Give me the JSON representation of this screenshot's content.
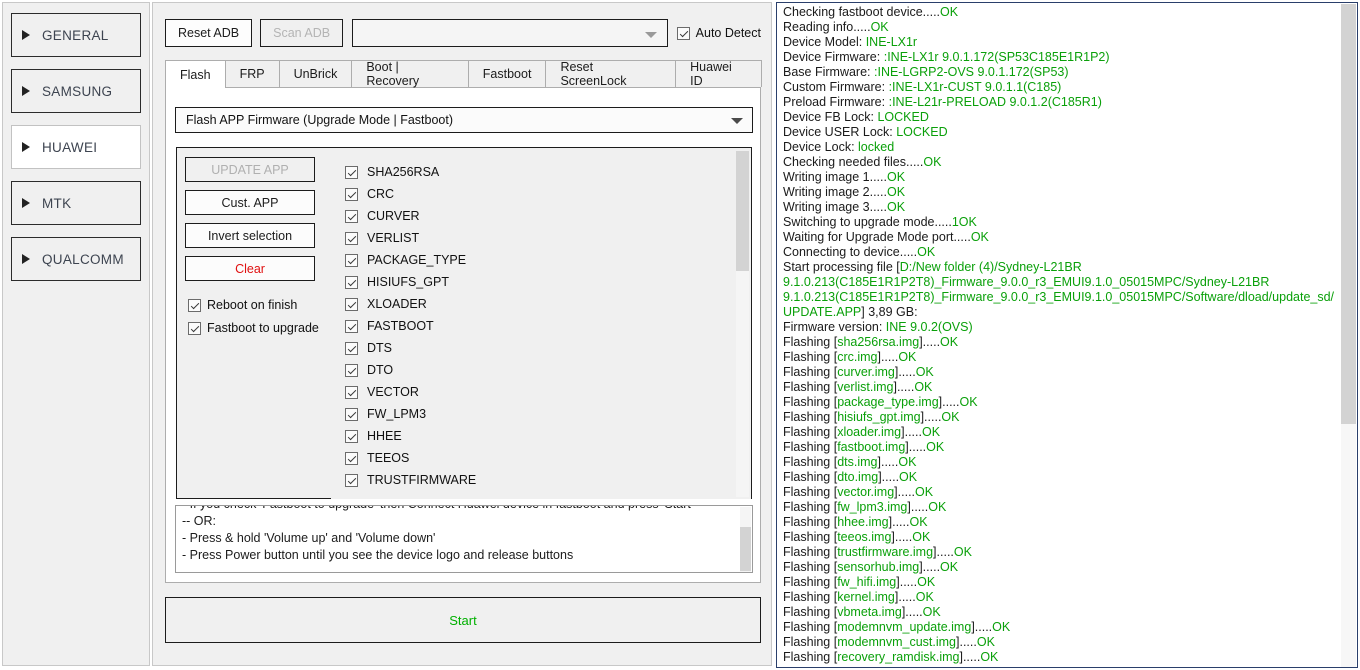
{
  "sidebar": {
    "items": [
      {
        "label": "GENERAL",
        "active": false
      },
      {
        "label": "SAMSUNG",
        "active": false
      },
      {
        "label": "HUAWEI",
        "active": true
      },
      {
        "label": "MTK",
        "active": false
      },
      {
        "label": "QUALCOMM",
        "active": false
      }
    ]
  },
  "toolbar": {
    "reset_adb": "Reset ADB",
    "scan_adb": "Scan ADB",
    "device_combo_value": "",
    "auto_detect_label": "Auto Detect",
    "auto_detect_checked": true
  },
  "tabs": [
    {
      "label": "Flash",
      "active": true
    },
    {
      "label": "FRP",
      "active": false
    },
    {
      "label": "UnBrick",
      "active": false
    },
    {
      "label": "Boot | Recovery",
      "active": false
    },
    {
      "label": "Fastboot",
      "active": false
    },
    {
      "label": "Reset ScreenLock",
      "active": false
    },
    {
      "label": "Huawei ID",
      "active": false
    }
  ],
  "flash": {
    "mode_value": "Flash APP Firmware (Upgrade Mode | Fastboot)",
    "buttons": [
      {
        "label": "UPDATE APP",
        "style": "dim"
      },
      {
        "label": "Cust. APP",
        "style": "normal"
      },
      {
        "label": "Invert selection",
        "style": "normal"
      },
      {
        "label": "Clear",
        "style": "danger"
      }
    ],
    "options": [
      {
        "label": "Reboot on finish",
        "checked": true
      },
      {
        "label": "Fastboot to upgrade",
        "checked": true
      }
    ],
    "partitions": [
      {
        "label": "SHA256RSA",
        "checked": true
      },
      {
        "label": "CRC",
        "checked": true
      },
      {
        "label": "CURVER",
        "checked": true
      },
      {
        "label": "VERLIST",
        "checked": true
      },
      {
        "label": "PACKAGE_TYPE",
        "checked": true
      },
      {
        "label": "HISIUFS_GPT",
        "checked": true
      },
      {
        "label": "XLOADER",
        "checked": true
      },
      {
        "label": "FASTBOOT",
        "checked": true
      },
      {
        "label": "DTS",
        "checked": true
      },
      {
        "label": "DTO",
        "checked": true
      },
      {
        "label": "VECTOR",
        "checked": true
      },
      {
        "label": "FW_LPM3",
        "checked": true
      },
      {
        "label": "HHEE",
        "checked": true
      },
      {
        "label": "TEEOS",
        "checked": true
      },
      {
        "label": "TRUSTFIRMWARE",
        "checked": true
      }
    ],
    "help_lines": [
      "- If you check 'Fastboot to upgrade' then Connect Huawei device in fastboot and press 'Start'",
      "-- OR:",
      "- Press & hold 'Volume up' and 'Volume down'",
      "- Press Power button until you see the device logo and release buttons"
    ],
    "start_label": "Start"
  },
  "log": {
    "lines": [
      [
        {
          "t": "Checking fastboot device.....",
          "c": "k"
        },
        {
          "t": "OK",
          "c": "g"
        }
      ],
      [
        {
          "t": "Reading info.....",
          "c": "k"
        },
        {
          "t": "OK",
          "c": "g"
        }
      ],
      [
        {
          "t": "Device Model: ",
          "c": "k"
        },
        {
          "t": "INE-LX1r",
          "c": "g"
        }
      ],
      [
        {
          "t": "Device Firmware: ",
          "c": "k"
        },
        {
          "t": ":INE-LX1r 9.0.1.172(SP53C185E1R1P2)",
          "c": "g"
        }
      ],
      [
        {
          "t": "Base Firmware: ",
          "c": "k"
        },
        {
          "t": ":INE-LGRP2-OVS 9.0.1.172(SP53)",
          "c": "g"
        }
      ],
      [
        {
          "t": "Custom Firmware: ",
          "c": "k"
        },
        {
          "t": ":INE-LX1r-CUST 9.0.1.1(C185)",
          "c": "g"
        }
      ],
      [
        {
          "t": "Preload Firmware: ",
          "c": "k"
        },
        {
          "t": ":INE-L21r-PRELOAD 9.0.1.2(C185R1)",
          "c": "g"
        }
      ],
      [
        {
          "t": "Device FB Lock: ",
          "c": "k"
        },
        {
          "t": "LOCKED",
          "c": "g"
        }
      ],
      [
        {
          "t": "Device USER Lock: ",
          "c": "k"
        },
        {
          "t": "LOCKED",
          "c": "g"
        }
      ],
      [
        {
          "t": "Device Lock: ",
          "c": "k"
        },
        {
          "t": "locked",
          "c": "g"
        }
      ],
      [
        {
          "t": "Checking needed files.....",
          "c": "k"
        },
        {
          "t": "OK",
          "c": "g"
        }
      ],
      [
        {
          "t": "Writing image 1.....",
          "c": "k"
        },
        {
          "t": "OK",
          "c": "g"
        }
      ],
      [
        {
          "t": "Writing image 2.....",
          "c": "k"
        },
        {
          "t": "OK",
          "c": "g"
        }
      ],
      [
        {
          "t": "Writing image 3.....",
          "c": "k"
        },
        {
          "t": "OK",
          "c": "g"
        }
      ],
      [
        {
          "t": "Switching to upgrade mode.....",
          "c": "k"
        },
        {
          "t": "1OK",
          "c": "g"
        }
      ],
      [
        {
          "t": "Waiting for Upgrade Mode port.....",
          "c": "k"
        },
        {
          "t": "OK",
          "c": "g"
        }
      ],
      [
        {
          "t": "Connecting to device.....",
          "c": "k"
        },
        {
          "t": "OK",
          "c": "g"
        }
      ],
      [
        {
          "t": "Start processing file [",
          "c": "k"
        },
        {
          "t": "D:/New folder (4)/Sydney-L21BR",
          "c": "g"
        }
      ],
      [
        {
          "t": "9.1.0.213(C185E1R1P2T8)_Firmware_9.0.0_r3_EMUI9.1.0_05015MPC/Sydney-L21BR",
          "c": "g"
        }
      ],
      [
        {
          "t": "9.1.0.213(C185E1R1P2T8)_Firmware_9.0.0_r3_EMUI9.1.0_05015MPC/Software/dload/update_sd/",
          "c": "g"
        }
      ],
      [
        {
          "t": "UPDATE.APP",
          "c": "g"
        },
        {
          "t": "] 3,89 GB:",
          "c": "k"
        }
      ],
      [
        {
          "t": "Firmware version: ",
          "c": "k"
        },
        {
          "t": "INE 9.0.2(OVS)",
          "c": "g"
        }
      ],
      [
        {
          "t": "Flashing [",
          "c": "k"
        },
        {
          "t": "sha256rsa.img",
          "c": "g"
        },
        {
          "t": "].....",
          "c": "k"
        },
        {
          "t": "OK",
          "c": "g"
        }
      ],
      [
        {
          "t": "Flashing [",
          "c": "k"
        },
        {
          "t": "crc.img",
          "c": "g"
        },
        {
          "t": "].....",
          "c": "k"
        },
        {
          "t": "OK",
          "c": "g"
        }
      ],
      [
        {
          "t": "Flashing [",
          "c": "k"
        },
        {
          "t": "curver.img",
          "c": "g"
        },
        {
          "t": "].....",
          "c": "k"
        },
        {
          "t": "OK",
          "c": "g"
        }
      ],
      [
        {
          "t": "Flashing [",
          "c": "k"
        },
        {
          "t": "verlist.img",
          "c": "g"
        },
        {
          "t": "].....",
          "c": "k"
        },
        {
          "t": "OK",
          "c": "g"
        }
      ],
      [
        {
          "t": "Flashing [",
          "c": "k"
        },
        {
          "t": "package_type.img",
          "c": "g"
        },
        {
          "t": "].....",
          "c": "k"
        },
        {
          "t": "OK",
          "c": "g"
        }
      ],
      [
        {
          "t": "Flashing [",
          "c": "k"
        },
        {
          "t": "hisiufs_gpt.img",
          "c": "g"
        },
        {
          "t": "].....",
          "c": "k"
        },
        {
          "t": "OK",
          "c": "g"
        }
      ],
      [
        {
          "t": "Flashing [",
          "c": "k"
        },
        {
          "t": "xloader.img",
          "c": "g"
        },
        {
          "t": "].....",
          "c": "k"
        },
        {
          "t": "OK",
          "c": "g"
        }
      ],
      [
        {
          "t": "Flashing [",
          "c": "k"
        },
        {
          "t": "fastboot.img",
          "c": "g"
        },
        {
          "t": "].....",
          "c": "k"
        },
        {
          "t": "OK",
          "c": "g"
        }
      ],
      [
        {
          "t": "Flashing [",
          "c": "k"
        },
        {
          "t": "dts.img",
          "c": "g"
        },
        {
          "t": "].....",
          "c": "k"
        },
        {
          "t": "OK",
          "c": "g"
        }
      ],
      [
        {
          "t": "Flashing [",
          "c": "k"
        },
        {
          "t": "dto.img",
          "c": "g"
        },
        {
          "t": "].....",
          "c": "k"
        },
        {
          "t": "OK",
          "c": "g"
        }
      ],
      [
        {
          "t": "Flashing [",
          "c": "k"
        },
        {
          "t": "vector.img",
          "c": "g"
        },
        {
          "t": "].....",
          "c": "k"
        },
        {
          "t": "OK",
          "c": "g"
        }
      ],
      [
        {
          "t": "Flashing [",
          "c": "k"
        },
        {
          "t": "fw_lpm3.img",
          "c": "g"
        },
        {
          "t": "].....",
          "c": "k"
        },
        {
          "t": "OK",
          "c": "g"
        }
      ],
      [
        {
          "t": "Flashing [",
          "c": "k"
        },
        {
          "t": "hhee.img",
          "c": "g"
        },
        {
          "t": "].....",
          "c": "k"
        },
        {
          "t": "OK",
          "c": "g"
        }
      ],
      [
        {
          "t": "Flashing [",
          "c": "k"
        },
        {
          "t": "teeos.img",
          "c": "g"
        },
        {
          "t": "].....",
          "c": "k"
        },
        {
          "t": "OK",
          "c": "g"
        }
      ],
      [
        {
          "t": "Flashing [",
          "c": "k"
        },
        {
          "t": "trustfirmware.img",
          "c": "g"
        },
        {
          "t": "].....",
          "c": "k"
        },
        {
          "t": "OK",
          "c": "g"
        }
      ],
      [
        {
          "t": "Flashing [",
          "c": "k"
        },
        {
          "t": "sensorhub.img",
          "c": "g"
        },
        {
          "t": "].....",
          "c": "k"
        },
        {
          "t": "OK",
          "c": "g"
        }
      ],
      [
        {
          "t": "Flashing [",
          "c": "k"
        },
        {
          "t": "fw_hifi.img",
          "c": "g"
        },
        {
          "t": "].....",
          "c": "k"
        },
        {
          "t": "OK",
          "c": "g"
        }
      ],
      [
        {
          "t": "Flashing [",
          "c": "k"
        },
        {
          "t": "kernel.img",
          "c": "g"
        },
        {
          "t": "].....",
          "c": "k"
        },
        {
          "t": "OK",
          "c": "g"
        }
      ],
      [
        {
          "t": "Flashing [",
          "c": "k"
        },
        {
          "t": "vbmeta.img",
          "c": "g"
        },
        {
          "t": "].....",
          "c": "k"
        },
        {
          "t": "OK",
          "c": "g"
        }
      ],
      [
        {
          "t": "Flashing [",
          "c": "k"
        },
        {
          "t": "modemnvm_update.img",
          "c": "g"
        },
        {
          "t": "].....",
          "c": "k"
        },
        {
          "t": "OK",
          "c": "g"
        }
      ],
      [
        {
          "t": "Flashing [",
          "c": "k"
        },
        {
          "t": "modemnvm_cust.img",
          "c": "g"
        },
        {
          "t": "].....",
          "c": "k"
        },
        {
          "t": "OK",
          "c": "g"
        }
      ],
      [
        {
          "t": "Flashing [",
          "c": "k"
        },
        {
          "t": "recovery_ramdisk.img",
          "c": "g"
        },
        {
          "t": "].....",
          "c": "k"
        },
        {
          "t": "OK",
          "c": "g"
        }
      ]
    ]
  },
  "colors": {
    "ok_green": "#0aa00a",
    "danger_red": "#e01010",
    "panel_bg": "#f0f0f0"
  }
}
